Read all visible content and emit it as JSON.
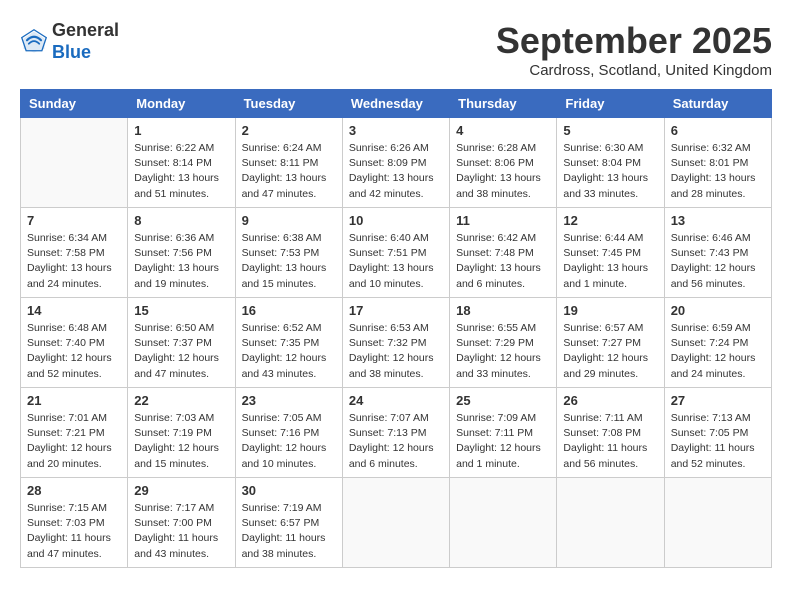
{
  "header": {
    "logo_general": "General",
    "logo_blue": "Blue",
    "month_title": "September 2025",
    "location": "Cardross, Scotland, United Kingdom"
  },
  "weekdays": [
    "Sunday",
    "Monday",
    "Tuesday",
    "Wednesday",
    "Thursday",
    "Friday",
    "Saturday"
  ],
  "weeks": [
    [
      {
        "day": "",
        "info": ""
      },
      {
        "day": "1",
        "info": "Sunrise: 6:22 AM\nSunset: 8:14 PM\nDaylight: 13 hours\nand 51 minutes."
      },
      {
        "day": "2",
        "info": "Sunrise: 6:24 AM\nSunset: 8:11 PM\nDaylight: 13 hours\nand 47 minutes."
      },
      {
        "day": "3",
        "info": "Sunrise: 6:26 AM\nSunset: 8:09 PM\nDaylight: 13 hours\nand 42 minutes."
      },
      {
        "day": "4",
        "info": "Sunrise: 6:28 AM\nSunset: 8:06 PM\nDaylight: 13 hours\nand 38 minutes."
      },
      {
        "day": "5",
        "info": "Sunrise: 6:30 AM\nSunset: 8:04 PM\nDaylight: 13 hours\nand 33 minutes."
      },
      {
        "day": "6",
        "info": "Sunrise: 6:32 AM\nSunset: 8:01 PM\nDaylight: 13 hours\nand 28 minutes."
      }
    ],
    [
      {
        "day": "7",
        "info": "Sunrise: 6:34 AM\nSunset: 7:58 PM\nDaylight: 13 hours\nand 24 minutes."
      },
      {
        "day": "8",
        "info": "Sunrise: 6:36 AM\nSunset: 7:56 PM\nDaylight: 13 hours\nand 19 minutes."
      },
      {
        "day": "9",
        "info": "Sunrise: 6:38 AM\nSunset: 7:53 PM\nDaylight: 13 hours\nand 15 minutes."
      },
      {
        "day": "10",
        "info": "Sunrise: 6:40 AM\nSunset: 7:51 PM\nDaylight: 13 hours\nand 10 minutes."
      },
      {
        "day": "11",
        "info": "Sunrise: 6:42 AM\nSunset: 7:48 PM\nDaylight: 13 hours\nand 6 minutes."
      },
      {
        "day": "12",
        "info": "Sunrise: 6:44 AM\nSunset: 7:45 PM\nDaylight: 13 hours\nand 1 minute."
      },
      {
        "day": "13",
        "info": "Sunrise: 6:46 AM\nSunset: 7:43 PM\nDaylight: 12 hours\nand 56 minutes."
      }
    ],
    [
      {
        "day": "14",
        "info": "Sunrise: 6:48 AM\nSunset: 7:40 PM\nDaylight: 12 hours\nand 52 minutes."
      },
      {
        "day": "15",
        "info": "Sunrise: 6:50 AM\nSunset: 7:37 PM\nDaylight: 12 hours\nand 47 minutes."
      },
      {
        "day": "16",
        "info": "Sunrise: 6:52 AM\nSunset: 7:35 PM\nDaylight: 12 hours\nand 43 minutes."
      },
      {
        "day": "17",
        "info": "Sunrise: 6:53 AM\nSunset: 7:32 PM\nDaylight: 12 hours\nand 38 minutes."
      },
      {
        "day": "18",
        "info": "Sunrise: 6:55 AM\nSunset: 7:29 PM\nDaylight: 12 hours\nand 33 minutes."
      },
      {
        "day": "19",
        "info": "Sunrise: 6:57 AM\nSunset: 7:27 PM\nDaylight: 12 hours\nand 29 minutes."
      },
      {
        "day": "20",
        "info": "Sunrise: 6:59 AM\nSunset: 7:24 PM\nDaylight: 12 hours\nand 24 minutes."
      }
    ],
    [
      {
        "day": "21",
        "info": "Sunrise: 7:01 AM\nSunset: 7:21 PM\nDaylight: 12 hours\nand 20 minutes."
      },
      {
        "day": "22",
        "info": "Sunrise: 7:03 AM\nSunset: 7:19 PM\nDaylight: 12 hours\nand 15 minutes."
      },
      {
        "day": "23",
        "info": "Sunrise: 7:05 AM\nSunset: 7:16 PM\nDaylight: 12 hours\nand 10 minutes."
      },
      {
        "day": "24",
        "info": "Sunrise: 7:07 AM\nSunset: 7:13 PM\nDaylight: 12 hours\nand 6 minutes."
      },
      {
        "day": "25",
        "info": "Sunrise: 7:09 AM\nSunset: 7:11 PM\nDaylight: 12 hours\nand 1 minute."
      },
      {
        "day": "26",
        "info": "Sunrise: 7:11 AM\nSunset: 7:08 PM\nDaylight: 11 hours\nand 56 minutes."
      },
      {
        "day": "27",
        "info": "Sunrise: 7:13 AM\nSunset: 7:05 PM\nDaylight: 11 hours\nand 52 minutes."
      }
    ],
    [
      {
        "day": "28",
        "info": "Sunrise: 7:15 AM\nSunset: 7:03 PM\nDaylight: 11 hours\nand 47 minutes."
      },
      {
        "day": "29",
        "info": "Sunrise: 7:17 AM\nSunset: 7:00 PM\nDaylight: 11 hours\nand 43 minutes."
      },
      {
        "day": "30",
        "info": "Sunrise: 7:19 AM\nSunset: 6:57 PM\nDaylight: 11 hours\nand 38 minutes."
      },
      {
        "day": "",
        "info": ""
      },
      {
        "day": "",
        "info": ""
      },
      {
        "day": "",
        "info": ""
      },
      {
        "day": "",
        "info": ""
      }
    ]
  ]
}
